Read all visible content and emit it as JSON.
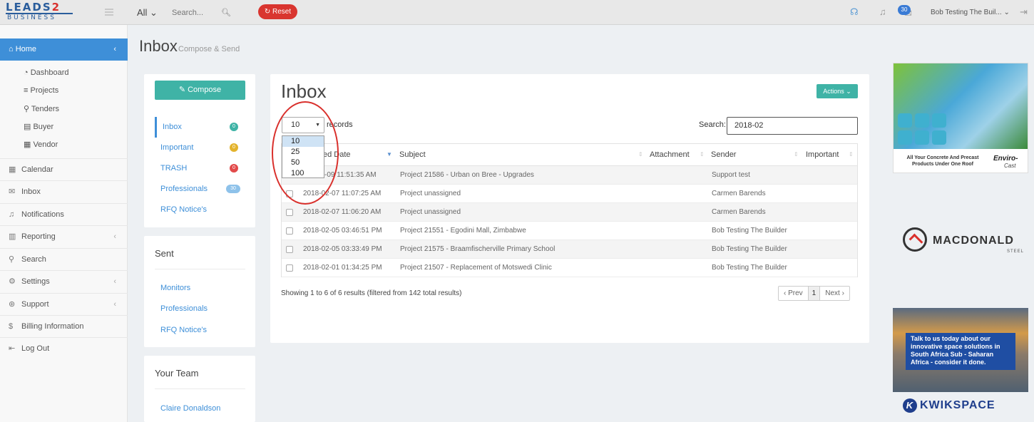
{
  "brand": {
    "line1": "LEADS",
    "line1_two": "2",
    "line2": "BUSINESS"
  },
  "topbar": {
    "scope_label": "All ⌄",
    "search_placeholder": "Search...",
    "reset_label": "Reset",
    "notif_count": "30",
    "user_name": "Bob Testing The Buil... ⌄"
  },
  "sidebar": {
    "home": "Home",
    "sub": [
      "Dashboard",
      "Projects",
      "Tenders",
      "Buyer",
      "Vendor"
    ],
    "items": [
      "Calendar",
      "Inbox",
      "Notifications",
      "Reporting",
      "Search",
      "Settings",
      "Support",
      "Billing Information",
      "Log Out"
    ]
  },
  "page": {
    "title": "Inbox",
    "subtitle": "Compose & Send"
  },
  "folders": {
    "compose": "Compose",
    "list": [
      {
        "label": "Inbox",
        "count": "0",
        "color": "#3fb3a6"
      },
      {
        "label": "Important",
        "count": "0",
        "color": "#e3b32c"
      },
      {
        "label": "TRASH",
        "count": "0",
        "color": "#e24a4a"
      },
      {
        "label": "Professionals",
        "count": "30",
        "color": "#8ec2ea"
      },
      {
        "label": "RFQ Notice's",
        "count": "",
        "color": ""
      }
    ],
    "sent_title": "Sent",
    "sent": [
      "Monitors",
      "Professionals",
      "RFQ Notice's"
    ],
    "team_title": "Your Team",
    "team": [
      "Claire Donaldson"
    ]
  },
  "inbox": {
    "heading": "Inbox",
    "actions": "Actions ⌄",
    "length_value": "10",
    "records_label": "records",
    "length_options": [
      "10",
      "25",
      "50",
      "100"
    ],
    "search_label": "Search:",
    "search_value": "2018-02",
    "columns": [
      "ed Date",
      "Subject",
      "Attachment",
      "Sender",
      "Important"
    ],
    "rows": [
      {
        "date": "2018-02-09 11:51:35 AM",
        "date_visible": "-09 11:51:35 AM",
        "subject": "Project 21586 - Urban on Bree - Upgrades",
        "sender": "Support test"
      },
      {
        "date": "2018-02-07 11:07:25 AM",
        "date_visible": "2018-02-07 11:07:25 AM",
        "subject": "Project unassigned",
        "sender": "Carmen Barends"
      },
      {
        "date": "2018-02-07 11:06:20 AM",
        "date_visible": "2018-02-07 11:06:20 AM",
        "subject": "Project unassigned",
        "sender": "Carmen Barends"
      },
      {
        "date": "2018-02-05 03:46:51 PM",
        "date_visible": "2018-02-05 03:46:51 PM",
        "subject": "Project 21551 - Egodini Mall, Zimbabwe",
        "sender": "Bob Testing The Builder"
      },
      {
        "date": "2018-02-05 03:33:49 PM",
        "date_visible": "2018-02-05 03:33:49 PM",
        "subject": "Project 21575 - Braamfischerville Primary School",
        "sender": "Bob Testing The Builder"
      },
      {
        "date": "2018-02-01 01:34:25 PM",
        "date_visible": "2018-02-01 01:34:25 PM",
        "subject": "Project 21507 - Replacement of Motswedi Clinic",
        "sender": "Bob Testing The Builder"
      }
    ],
    "showing": "Showing 1 to 6 of 6 results (filtered from 142 total results)",
    "prev": "‹ Prev",
    "page": "1",
    "next": "Next ›"
  },
  "ads": {
    "enviro_text": "All Your Concrete And Precast Products Under One Roof",
    "enviro_brand": "Enviro-",
    "enviro_brand2": "Cast",
    "macdonald": "MACDONALD",
    "macdonald_sub": "STEEL",
    "kwik_text": "Talk to us today about our innovative space solutions in South Africa Sub - Saharan Africa - consider it done.",
    "kwik_brand": "KWIKSPACE"
  }
}
